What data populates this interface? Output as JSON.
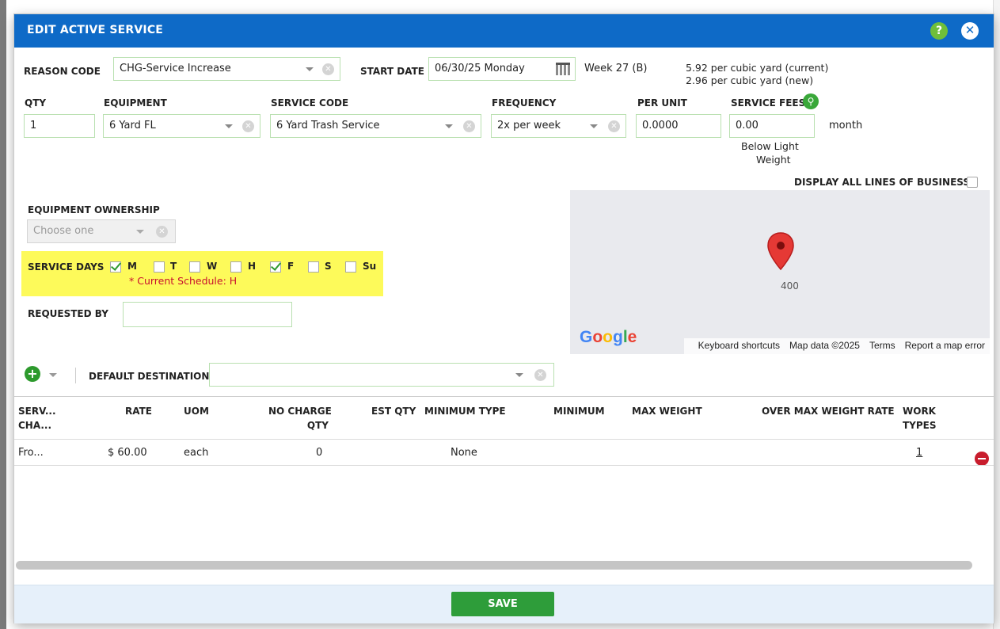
{
  "dialog": {
    "title": "EDIT ACTIVE SERVICE",
    "help_label": "?",
    "close_label": "✕"
  },
  "reason_code": {
    "label": "REASON CODE",
    "value": "CHG-Service Increase"
  },
  "start_date": {
    "label": "START DATE",
    "value": "06/30/25 Monday",
    "week": "Week 27 (B)"
  },
  "rate_info": {
    "current": "5.92 per cubic yard (current)",
    "new": "2.96 per cubic yard (new)"
  },
  "fields": {
    "qty": {
      "label": "QTY",
      "value": "1"
    },
    "equipment": {
      "label": "EQUIPMENT",
      "value": "6 Yard FL"
    },
    "service_code": {
      "label": "SERVICE CODE",
      "value": "6 Yard Trash Service"
    },
    "frequency": {
      "label": "FREQUENCY",
      "value": "2x per week"
    },
    "per_unit": {
      "label": "PER UNIT",
      "value": "0.0000"
    },
    "service_fees": {
      "label": "SERVICE FEES",
      "value": "0.00",
      "period": "month",
      "note_line1": "Below Light",
      "note_line2": "Weight"
    }
  },
  "display_all_lob": {
    "label": "DISPLAY ALL LINES OF BUSINESS",
    "checked": false
  },
  "equipment_ownership": {
    "label": "EQUIPMENT OWNERSHIP",
    "placeholder": "Choose one"
  },
  "service_days": {
    "label": "SERVICE DAYS",
    "days": [
      {
        "label": "M",
        "checked": true
      },
      {
        "label": "T",
        "checked": false
      },
      {
        "label": "W",
        "checked": false
      },
      {
        "label": "H",
        "checked": false
      },
      {
        "label": "F",
        "checked": true
      },
      {
        "label": "S",
        "checked": false
      },
      {
        "label": "Su",
        "checked": false
      }
    ],
    "current_schedule": "* Current Schedule: H"
  },
  "requested_by": {
    "label": "REQUESTED BY",
    "value": ""
  },
  "map": {
    "pin_label": "400",
    "logo": "Google",
    "footer": [
      "Keyboard shortcuts",
      "Map data ©2025",
      "Terms",
      "Report a map error"
    ]
  },
  "default_destination": {
    "label": "DEFAULT DESTINATION",
    "value": ""
  },
  "grid": {
    "headers": [
      {
        "line1": "SERV...",
        "line2": "CHA..."
      },
      {
        "line1": "RATE",
        "line2": ""
      },
      {
        "line1": "UOM",
        "line2": ""
      },
      {
        "line1": "NO CHARGE",
        "line2": "QTY"
      },
      {
        "line1": "EST QTY",
        "line2": ""
      },
      {
        "line1": "MINIMUM TYPE",
        "line2": ""
      },
      {
        "line1": "MINIMUM",
        "line2": ""
      },
      {
        "line1": "MAX WEIGHT",
        "line2": ""
      },
      {
        "line1": "OVER MAX WEIGHT RATE",
        "line2": ""
      },
      {
        "line1": "WORK",
        "line2": "TYPES"
      }
    ],
    "rows": [
      {
        "service_charge": "Fro...",
        "rate": "$ 60.00",
        "uom": "each",
        "no_charge_qty": "0",
        "est_qty": "",
        "minimum_type": "None",
        "minimum": "",
        "max_weight": "",
        "over_max_weight_rate": "",
        "work_types": "1"
      }
    ]
  },
  "footer": {
    "save_label": "SAVE"
  },
  "colors": {
    "header": "#0e6ac7",
    "highlight": "#fdfa5a",
    "save": "#2e9d3a",
    "error_text": "#c8102e",
    "remove": "#c81d2d"
  }
}
